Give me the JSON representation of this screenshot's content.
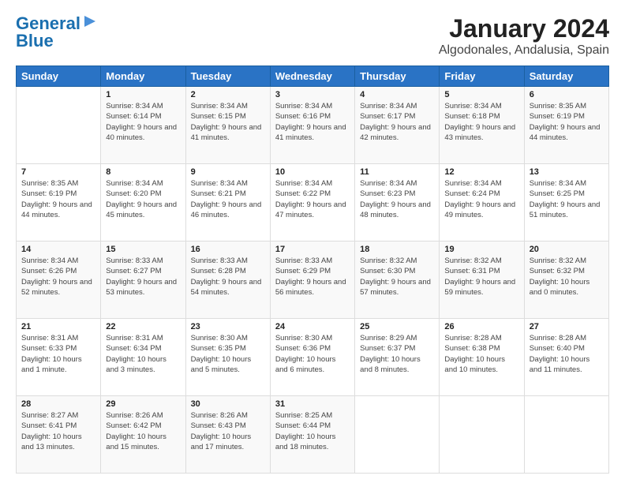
{
  "header": {
    "logo_line1": "General",
    "logo_line2": "Blue",
    "title": "January 2024",
    "subtitle": "Algodonales, Andalusia, Spain"
  },
  "days_of_week": [
    "Sunday",
    "Monday",
    "Tuesday",
    "Wednesday",
    "Thursday",
    "Friday",
    "Saturday"
  ],
  "weeks": [
    [
      {
        "day": "",
        "sunrise": "",
        "sunset": "",
        "daylight": ""
      },
      {
        "day": "1",
        "sunrise": "Sunrise: 8:34 AM",
        "sunset": "Sunset: 6:14 PM",
        "daylight": "Daylight: 9 hours and 40 minutes."
      },
      {
        "day": "2",
        "sunrise": "Sunrise: 8:34 AM",
        "sunset": "Sunset: 6:15 PM",
        "daylight": "Daylight: 9 hours and 41 minutes."
      },
      {
        "day": "3",
        "sunrise": "Sunrise: 8:34 AM",
        "sunset": "Sunset: 6:16 PM",
        "daylight": "Daylight: 9 hours and 41 minutes."
      },
      {
        "day": "4",
        "sunrise": "Sunrise: 8:34 AM",
        "sunset": "Sunset: 6:17 PM",
        "daylight": "Daylight: 9 hours and 42 minutes."
      },
      {
        "day": "5",
        "sunrise": "Sunrise: 8:34 AM",
        "sunset": "Sunset: 6:18 PM",
        "daylight": "Daylight: 9 hours and 43 minutes."
      },
      {
        "day": "6",
        "sunrise": "Sunrise: 8:35 AM",
        "sunset": "Sunset: 6:19 PM",
        "daylight": "Daylight: 9 hours and 44 minutes."
      }
    ],
    [
      {
        "day": "7",
        "sunrise": "Sunrise: 8:35 AM",
        "sunset": "Sunset: 6:19 PM",
        "daylight": "Daylight: 9 hours and 44 minutes."
      },
      {
        "day": "8",
        "sunrise": "Sunrise: 8:34 AM",
        "sunset": "Sunset: 6:20 PM",
        "daylight": "Daylight: 9 hours and 45 minutes."
      },
      {
        "day": "9",
        "sunrise": "Sunrise: 8:34 AM",
        "sunset": "Sunset: 6:21 PM",
        "daylight": "Daylight: 9 hours and 46 minutes."
      },
      {
        "day": "10",
        "sunrise": "Sunrise: 8:34 AM",
        "sunset": "Sunset: 6:22 PM",
        "daylight": "Daylight: 9 hours and 47 minutes."
      },
      {
        "day": "11",
        "sunrise": "Sunrise: 8:34 AM",
        "sunset": "Sunset: 6:23 PM",
        "daylight": "Daylight: 9 hours and 48 minutes."
      },
      {
        "day": "12",
        "sunrise": "Sunrise: 8:34 AM",
        "sunset": "Sunset: 6:24 PM",
        "daylight": "Daylight: 9 hours and 49 minutes."
      },
      {
        "day": "13",
        "sunrise": "Sunrise: 8:34 AM",
        "sunset": "Sunset: 6:25 PM",
        "daylight": "Daylight: 9 hours and 51 minutes."
      }
    ],
    [
      {
        "day": "14",
        "sunrise": "Sunrise: 8:34 AM",
        "sunset": "Sunset: 6:26 PM",
        "daylight": "Daylight: 9 hours and 52 minutes."
      },
      {
        "day": "15",
        "sunrise": "Sunrise: 8:33 AM",
        "sunset": "Sunset: 6:27 PM",
        "daylight": "Daylight: 9 hours and 53 minutes."
      },
      {
        "day": "16",
        "sunrise": "Sunrise: 8:33 AM",
        "sunset": "Sunset: 6:28 PM",
        "daylight": "Daylight: 9 hours and 54 minutes."
      },
      {
        "day": "17",
        "sunrise": "Sunrise: 8:33 AM",
        "sunset": "Sunset: 6:29 PM",
        "daylight": "Daylight: 9 hours and 56 minutes."
      },
      {
        "day": "18",
        "sunrise": "Sunrise: 8:32 AM",
        "sunset": "Sunset: 6:30 PM",
        "daylight": "Daylight: 9 hours and 57 minutes."
      },
      {
        "day": "19",
        "sunrise": "Sunrise: 8:32 AM",
        "sunset": "Sunset: 6:31 PM",
        "daylight": "Daylight: 9 hours and 59 minutes."
      },
      {
        "day": "20",
        "sunrise": "Sunrise: 8:32 AM",
        "sunset": "Sunset: 6:32 PM",
        "daylight": "Daylight: 10 hours and 0 minutes."
      }
    ],
    [
      {
        "day": "21",
        "sunrise": "Sunrise: 8:31 AM",
        "sunset": "Sunset: 6:33 PM",
        "daylight": "Daylight: 10 hours and 1 minute."
      },
      {
        "day": "22",
        "sunrise": "Sunrise: 8:31 AM",
        "sunset": "Sunset: 6:34 PM",
        "daylight": "Daylight: 10 hours and 3 minutes."
      },
      {
        "day": "23",
        "sunrise": "Sunrise: 8:30 AM",
        "sunset": "Sunset: 6:35 PM",
        "daylight": "Daylight: 10 hours and 5 minutes."
      },
      {
        "day": "24",
        "sunrise": "Sunrise: 8:30 AM",
        "sunset": "Sunset: 6:36 PM",
        "daylight": "Daylight: 10 hours and 6 minutes."
      },
      {
        "day": "25",
        "sunrise": "Sunrise: 8:29 AM",
        "sunset": "Sunset: 6:37 PM",
        "daylight": "Daylight: 10 hours and 8 minutes."
      },
      {
        "day": "26",
        "sunrise": "Sunrise: 8:28 AM",
        "sunset": "Sunset: 6:38 PM",
        "daylight": "Daylight: 10 hours and 10 minutes."
      },
      {
        "day": "27",
        "sunrise": "Sunrise: 8:28 AM",
        "sunset": "Sunset: 6:40 PM",
        "daylight": "Daylight: 10 hours and 11 minutes."
      }
    ],
    [
      {
        "day": "28",
        "sunrise": "Sunrise: 8:27 AM",
        "sunset": "Sunset: 6:41 PM",
        "daylight": "Daylight: 10 hours and 13 minutes."
      },
      {
        "day": "29",
        "sunrise": "Sunrise: 8:26 AM",
        "sunset": "Sunset: 6:42 PM",
        "daylight": "Daylight: 10 hours and 15 minutes."
      },
      {
        "day": "30",
        "sunrise": "Sunrise: 8:26 AM",
        "sunset": "Sunset: 6:43 PM",
        "daylight": "Daylight: 10 hours and 17 minutes."
      },
      {
        "day": "31",
        "sunrise": "Sunrise: 8:25 AM",
        "sunset": "Sunset: 6:44 PM",
        "daylight": "Daylight: 10 hours and 18 minutes."
      },
      {
        "day": "",
        "sunrise": "",
        "sunset": "",
        "daylight": ""
      },
      {
        "day": "",
        "sunrise": "",
        "sunset": "",
        "daylight": ""
      },
      {
        "day": "",
        "sunrise": "",
        "sunset": "",
        "daylight": ""
      }
    ]
  ]
}
